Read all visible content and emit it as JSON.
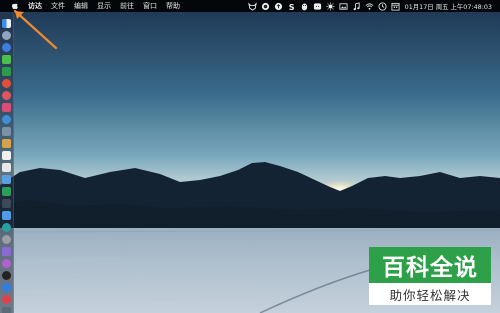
{
  "menubar": {
    "apple_icon": "apple-icon",
    "items": [
      {
        "label": "访达",
        "bold": true
      },
      {
        "label": "文件"
      },
      {
        "label": "编辑"
      },
      {
        "label": "显示"
      },
      {
        "label": "前往"
      },
      {
        "label": "窗口"
      },
      {
        "label": "帮助"
      }
    ],
    "status_icons": [
      "fox-icon",
      "dark-circle-icon",
      "upload-circle-icon",
      "s-icon",
      "qq-penguin-icon",
      "wechat-icon",
      "brightness-icon",
      "image-icon",
      "music-icon",
      "wifi-icon",
      "time-machine-icon",
      "calendar-icon"
    ],
    "clock": "01月17日 周五 上午07:48:03"
  },
  "dock": {
    "icons": [
      "finder-icon",
      "launchpad-icon",
      "safari-icon",
      "wechat-icon",
      "chrome-icon",
      "red-app-icon",
      "photos-icon",
      "music-app-icon",
      "appstore-icon",
      "notes-icon",
      "calendar-icon",
      "files-icon",
      "preview-icon",
      "qq-icon",
      "green-app-icon",
      "terminal-icon",
      "finder-icon",
      "edge-icon",
      "settings-icon",
      "app-icon",
      "podcast-icon",
      "tv-icon",
      "appstore-blue-icon",
      "music-red-icon",
      "trash-icon",
      "ring-icon"
    ]
  },
  "watermark": {
    "top": "百科全说",
    "bottom": "助你轻松解决"
  },
  "colors": {
    "menubar_bg": "#0d0d0d",
    "watermark_green": "#2fa04a",
    "arrow": "#f08a30"
  }
}
